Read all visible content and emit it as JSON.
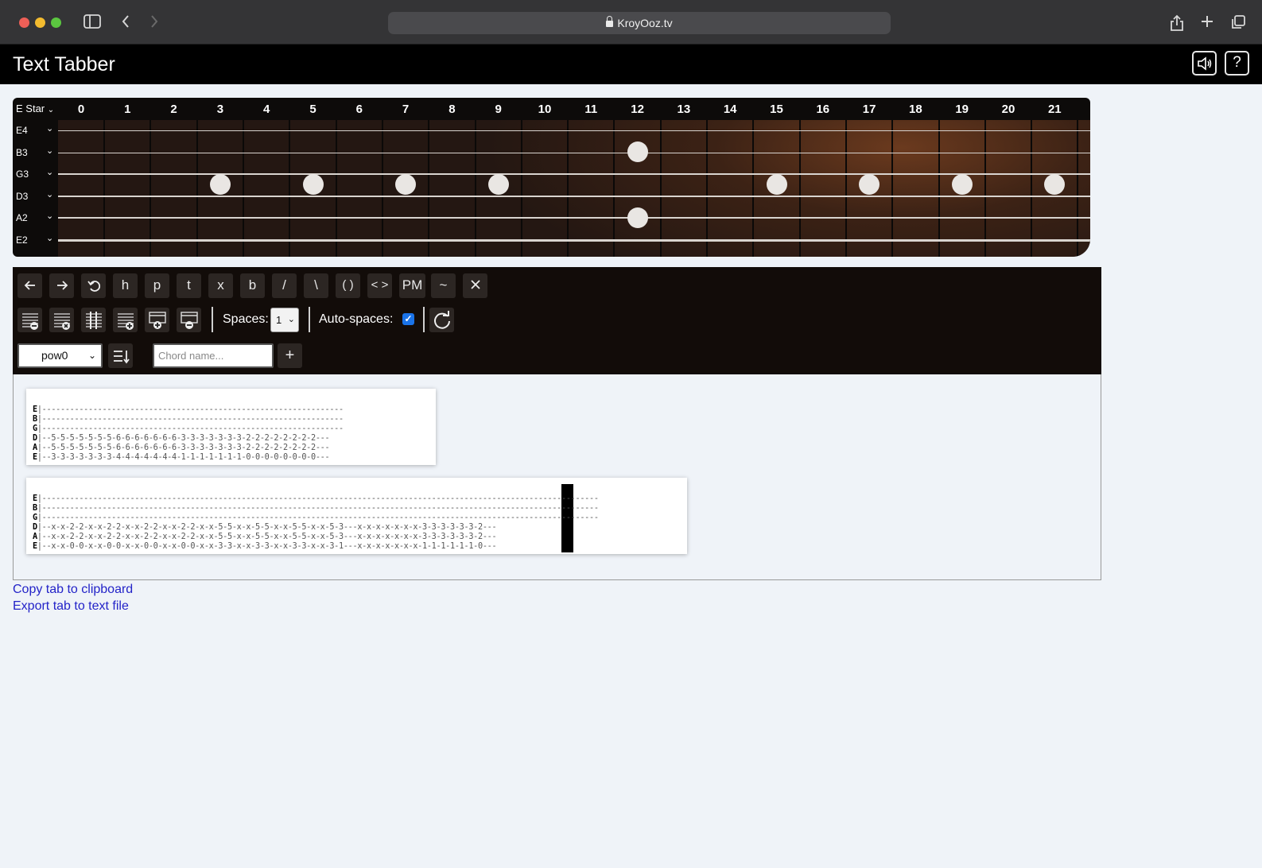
{
  "browser": {
    "url": "KroyOoz.tv"
  },
  "app": {
    "title": "Text Tabber"
  },
  "fretboard": {
    "tuning_label": "E Star",
    "frets": [
      "0",
      "1",
      "2",
      "3",
      "4",
      "5",
      "6",
      "7",
      "8",
      "9",
      "10",
      "11",
      "12",
      "13",
      "14",
      "15",
      "16",
      "17",
      "18",
      "19",
      "20",
      "21"
    ],
    "strings": [
      "E4",
      "B3",
      "G3",
      "D3",
      "A2",
      "E2"
    ]
  },
  "toolbar": {
    "buttons": [
      "h",
      "p",
      "t",
      "x",
      "b",
      "/",
      "\\",
      "( )",
      "< >",
      "PM",
      "~"
    ],
    "spaces_label": "Spaces:",
    "spaces_value": "1",
    "auto_spaces_label": "Auto-spaces:",
    "auto_spaces_checked": true,
    "chord_select_value": "pow0",
    "chord_name_placeholder": "Chord name...",
    "add_label": "+"
  },
  "tabs": [
    {
      "lines": [
        [
          "E",
          "|-----------------------------------------------------------------"
        ],
        [
          "B",
          "|-----------------------------------------------------------------"
        ],
        [
          "G",
          "|-----------------------------------------------------------------"
        ],
        [
          "D",
          "|--5-5-5-5-5-5-5-6-6-6-6-6-6-6-3-3-3-3-3-3-3-2-2-2-2-2-2-2-2---"
        ],
        [
          "A",
          "|--5-5-5-5-5-5-5-6-6-6-6-6-6-6-3-3-3-3-3-3-3-2-2-2-2-2-2-2-2---"
        ],
        [
          "E",
          "|--3-3-3-3-3-3-3-4-4-4-4-4-4-4-1-1-1-1-1-1-1-0-0-0-0-0-0-0-0---"
        ]
      ]
    },
    {
      "lines": [
        [
          "E",
          "|------------------------------------------------------------------------------------------------------------------------"
        ],
        [
          "B",
          "|------------------------------------------------------------------------------------------------------------------------"
        ],
        [
          "G",
          "|------------------------------------------------------------------------------------------------------------------------"
        ],
        [
          "D",
          "|--x-x-2-2-x-x-2-2-x-x-2-2-x-x-2-2-x-x-5-5-x-x-5-5-x-x-5-5-x-x-5-3---x-x-x-x-x-x-x-3-3-3-3-3-3-2---"
        ],
        [
          "A",
          "|--x-x-2-2-x-x-2-2-x-x-2-2-x-x-2-2-x-x-5-5-x-x-5-5-x-x-5-5-x-x-5-3---x-x-x-x-x-x-x-3-3-3-3-3-3-2---"
        ],
        [
          "E",
          "|--x-x-0-0-x-x-0-0-x-x-0-0-x-x-0-0-x-x-3-3-x-x-3-3-x-x-3-3-x-x-3-1---x-x-x-x-x-x-x-1-1-1-1-1-1-0---"
        ]
      ]
    }
  ],
  "links": {
    "copy": "Copy tab to clipboard",
    "export": "Export tab to text file"
  }
}
